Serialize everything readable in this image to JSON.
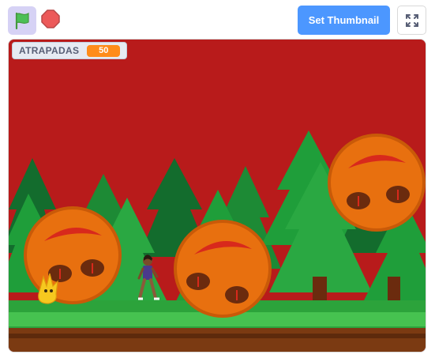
{
  "toolbar": {
    "green_flag": {
      "icon": "green-flag-icon",
      "color": "#4cbf56",
      "active": true
    },
    "stop": {
      "icon": "stop-icon",
      "color": "#ec5959"
    },
    "set_thumbnail_label": "Set Thumbnail",
    "fullscreen": {
      "icon": "fullscreen-icon"
    }
  },
  "stage": {
    "background_color": "#b81b1b",
    "monitor": {
      "label": "ATRAPADAS",
      "value": "50",
      "value_color": "#ff8c1a"
    },
    "sprites": [
      {
        "name": "ball",
        "icon": "orange-ball-icon"
      },
      {
        "name": "ball",
        "icon": "orange-ball-icon"
      },
      {
        "name": "ball",
        "icon": "orange-ball-icon"
      },
      {
        "name": "flame-cat",
        "icon": "yellow-creature-icon"
      },
      {
        "name": "walking-person",
        "icon": "person-icon"
      }
    ]
  },
  "colors": {
    "accent": "#4c97ff",
    "ball": "#e8700f",
    "tree_dark": "#136c2d",
    "tree_light": "#1f9e3a",
    "grass": "#2ca33b",
    "dirt": "#7b3a12"
  }
}
